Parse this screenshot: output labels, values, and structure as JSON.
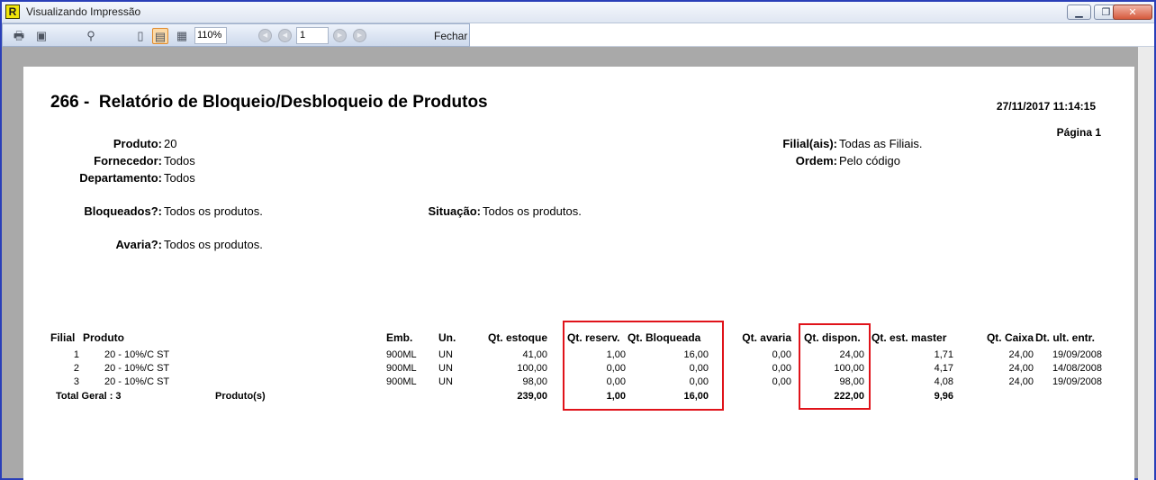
{
  "window": {
    "title": "Visualizando Impressão",
    "app_icon": "R"
  },
  "toolbar": {
    "zoom": "110%",
    "page": "1",
    "close_label": "Fechar"
  },
  "report": {
    "title": "266 -  Relatório de Bloqueio/Desbloqueio de Produtos",
    "datetime": "27/11/2017 11:14:15",
    "page_label": "Página 1",
    "filters": {
      "produto": {
        "label": "Produto:",
        "value": "20"
      },
      "fornecedor": {
        "label": "Fornecedor:",
        "value": "Todos"
      },
      "departamento": {
        "label": "Departamento:",
        "value": "Todos"
      },
      "bloqueados": {
        "label": "Bloqueados?:",
        "value": "Todos os produtos."
      },
      "situacao": {
        "label": "Situação:",
        "value": "Todos os produtos."
      },
      "avaria": {
        "label": "Avaria?:",
        "value": "Todos os produtos."
      },
      "filial": {
        "label": "Filial(ais):",
        "value": "Todas as Filiais."
      },
      "ordem": {
        "label": "Ordem:",
        "value": "Pelo código"
      }
    },
    "columns": {
      "filial": "Filial",
      "produto": "Produto",
      "emb": "Emb.",
      "un": "Un.",
      "qt_estoque": "Qt. estoque",
      "qt_reserv": "Qt. reserv.",
      "qt_bloqueada": "Qt. Bloqueada",
      "qt_avaria": "Qt. avaria",
      "qt_dispon": "Qt. dispon.",
      "qt_est_master": "Qt. est. master",
      "qt_caixa": "Qt. Caixa",
      "dt_ult_entr": "Dt. ult. entr."
    },
    "rows": [
      {
        "filial": "1",
        "produto": "20 - 10%/C ST",
        "emb": "900ML",
        "un": "UN",
        "qt_estoque": "41,00",
        "qt_reserv": "1,00",
        "qt_bloqueada": "16,00",
        "qt_avaria": "0,00",
        "qt_dispon": "24,00",
        "qt_est_master": "1,71",
        "qt_caixa": "24,00",
        "dt_ult_entr": "19/09/2008"
      },
      {
        "filial": "2",
        "produto": "20 - 10%/C ST",
        "emb": "900ML",
        "un": "UN",
        "qt_estoque": "100,00",
        "qt_reserv": "0,00",
        "qt_bloqueada": "0,00",
        "qt_avaria": "0,00",
        "qt_dispon": "100,00",
        "qt_est_master": "4,17",
        "qt_caixa": "24,00",
        "dt_ult_entr": "14/08/2008"
      },
      {
        "filial": "3",
        "produto": "20 - 10%/C ST",
        "emb": "900ML",
        "un": "UN",
        "qt_estoque": "98,00",
        "qt_reserv": "0,00",
        "qt_bloqueada": "0,00",
        "qt_avaria": "0,00",
        "qt_dispon": "98,00",
        "qt_est_master": "4,08",
        "qt_caixa": "24,00",
        "dt_ult_entr": "19/09/2008"
      }
    ],
    "total": {
      "label": "Total Geral : 3",
      "unit": "Produto(s)",
      "qt_estoque": "239,00",
      "qt_reserv": "1,00",
      "qt_bloqueada": "16,00",
      "qt_dispon": "222,00",
      "qt_est_master": "9,96"
    }
  },
  "colors": {
    "highlight": "#e0131a",
    "window_border": "#2a3fb8"
  }
}
